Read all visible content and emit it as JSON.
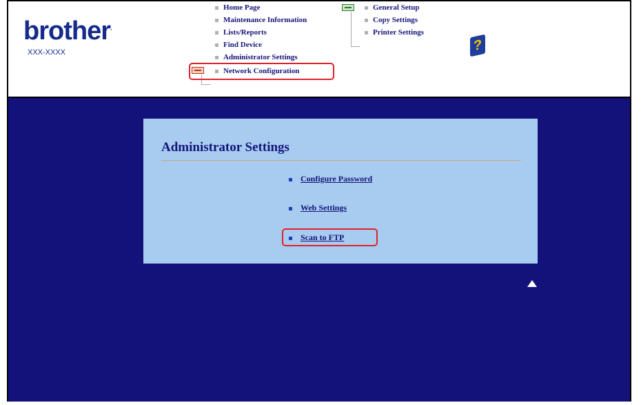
{
  "header": {
    "logo_text": "brother",
    "logo_reg": ".",
    "model_number": "XXX-XXXX"
  },
  "nav": {
    "left_items": [
      {
        "label": "Home Page"
      },
      {
        "label": "Maintenance Information"
      },
      {
        "label": "Lists/Reports"
      },
      {
        "label": "Find Device"
      },
      {
        "label": "Administrator Settings",
        "selected": true
      },
      {
        "label": "Network Configuration"
      }
    ],
    "right_items": [
      {
        "label": "General Setup"
      },
      {
        "label": "Copy Settings"
      },
      {
        "label": "Printer Settings"
      }
    ],
    "help_icon_glyph": "?"
  },
  "panel": {
    "title": "Administrator Settings",
    "links": [
      {
        "label": "Configure Password"
      },
      {
        "label": "Web Settings"
      },
      {
        "label": "Scan to FTP",
        "highlighted": true
      }
    ]
  },
  "colors": {
    "brand": "#142a8c",
    "main_background": "#12127a",
    "panel_background": "#a8ccf0",
    "highlight": "#e0202a"
  },
  "icons": {
    "up_arrow": "back-to-top-arrow-icon",
    "help": "help-icon",
    "key": "key-icon"
  }
}
